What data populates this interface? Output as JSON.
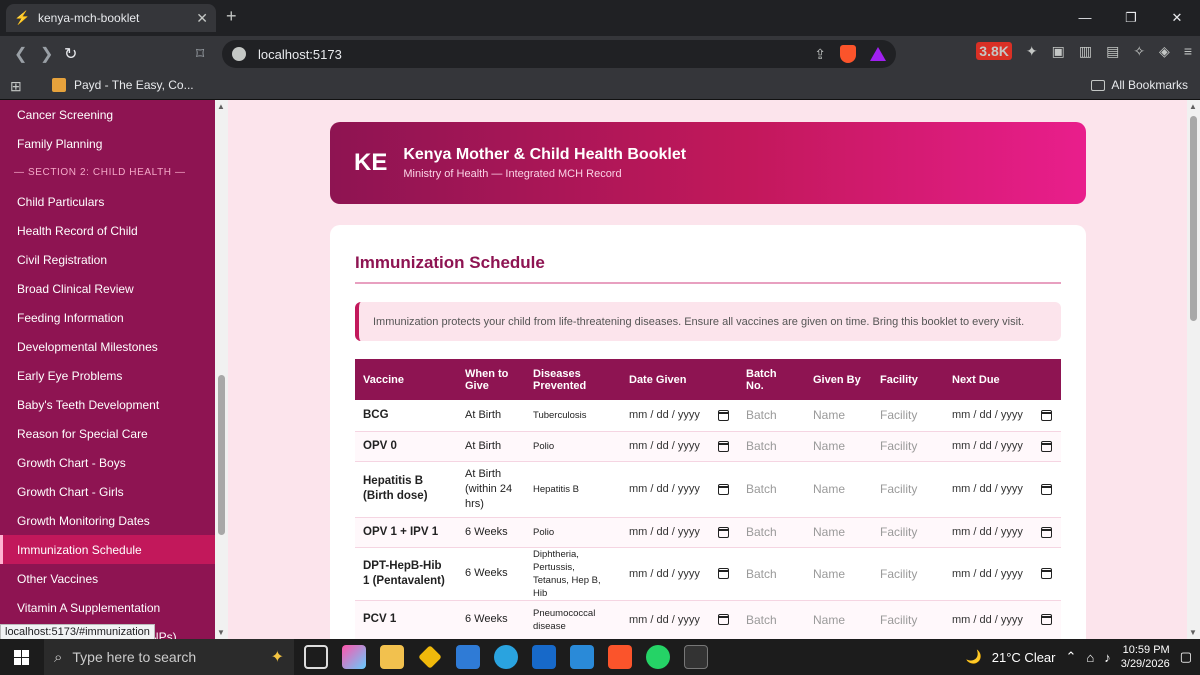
{
  "browser": {
    "tab_title": "kenya-mch-booklet",
    "url": "localhost:5173",
    "bookmark_label": "Payd - The Easy, Co...",
    "all_bookmarks": "All Bookmarks",
    "extension_badge": "3.8K"
  },
  "header": {
    "badge": "KE",
    "title": "Kenya Mother & Child Health Booklet",
    "subtitle": "Ministry of Health — Integrated MCH Record"
  },
  "sidebar": {
    "items": [
      {
        "label": "Cancer Screening"
      },
      {
        "label": "Family Planning"
      },
      {
        "label": "— SECTION 2: CHILD HEALTH —"
      },
      {
        "label": "Child Particulars"
      },
      {
        "label": "Health Record of Child"
      },
      {
        "label": "Civil Registration"
      },
      {
        "label": "Broad Clinical Review"
      },
      {
        "label": "Feeding Information"
      },
      {
        "label": "Developmental Milestones"
      },
      {
        "label": "Early Eye Problems"
      },
      {
        "label": "Baby's Teeth Development"
      },
      {
        "label": "Reason for Special Care"
      },
      {
        "label": "Growth Chart - Boys"
      },
      {
        "label": "Growth Chart - Girls"
      },
      {
        "label": "Growth Monitoring Dates"
      },
      {
        "label": "Immunization Schedule"
      },
      {
        "label": "Other Vaccines"
      },
      {
        "label": "Vitamin A Supplementation"
      },
      {
        "label": "NPs)"
      }
    ],
    "active_label": "Immunization Schedule"
  },
  "status_tooltip": "localhost:5173/#immunization",
  "immunization": {
    "title": "Immunization Schedule",
    "notice": "Immunization protects your child from life-threatening diseases. Ensure all vaccines are given on time. Bring this booklet to every visit.",
    "columns": [
      "Vaccine",
      "When to Give",
      "Diseases Prevented",
      "Date Given",
      "Batch No.",
      "Given By",
      "Facility",
      "Next Due"
    ],
    "date_placeholder": "mm / dd / yyyy",
    "batch_placeholder": "Batch",
    "name_placeholder": "Name",
    "facility_placeholder": "Facility",
    "rows": [
      {
        "vaccine": "BCG",
        "when": "At Birth",
        "diseases": "Tuberculosis"
      },
      {
        "vaccine": "OPV 0",
        "when": "At Birth",
        "diseases": "Polio"
      },
      {
        "vaccine": "Hepatitis B (Birth dose)",
        "when": "At Birth (within 24 hrs)",
        "diseases": "Hepatitis B"
      },
      {
        "vaccine": "OPV 1 + IPV 1",
        "when": "6 Weeks",
        "diseases": "Polio"
      },
      {
        "vaccine": "DPT-HepB-Hib 1 (Pentavalent)",
        "when": "6 Weeks",
        "diseases": "Diphtheria, Pertussis, Tetanus, Hep B, Hib"
      },
      {
        "vaccine": "PCV 1",
        "when": "6 Weeks",
        "diseases": "Pneumococcal disease"
      }
    ]
  },
  "taskbar": {
    "search_placeholder": "Type here to search",
    "weather": "21°C  Clear",
    "time": "10:59 PM",
    "date": "3/29/2026",
    "notif_count": "1"
  },
  "colors": {
    "primary": "#8e1452",
    "accent": "#c2185b",
    "background": "#fce4ec"
  }
}
